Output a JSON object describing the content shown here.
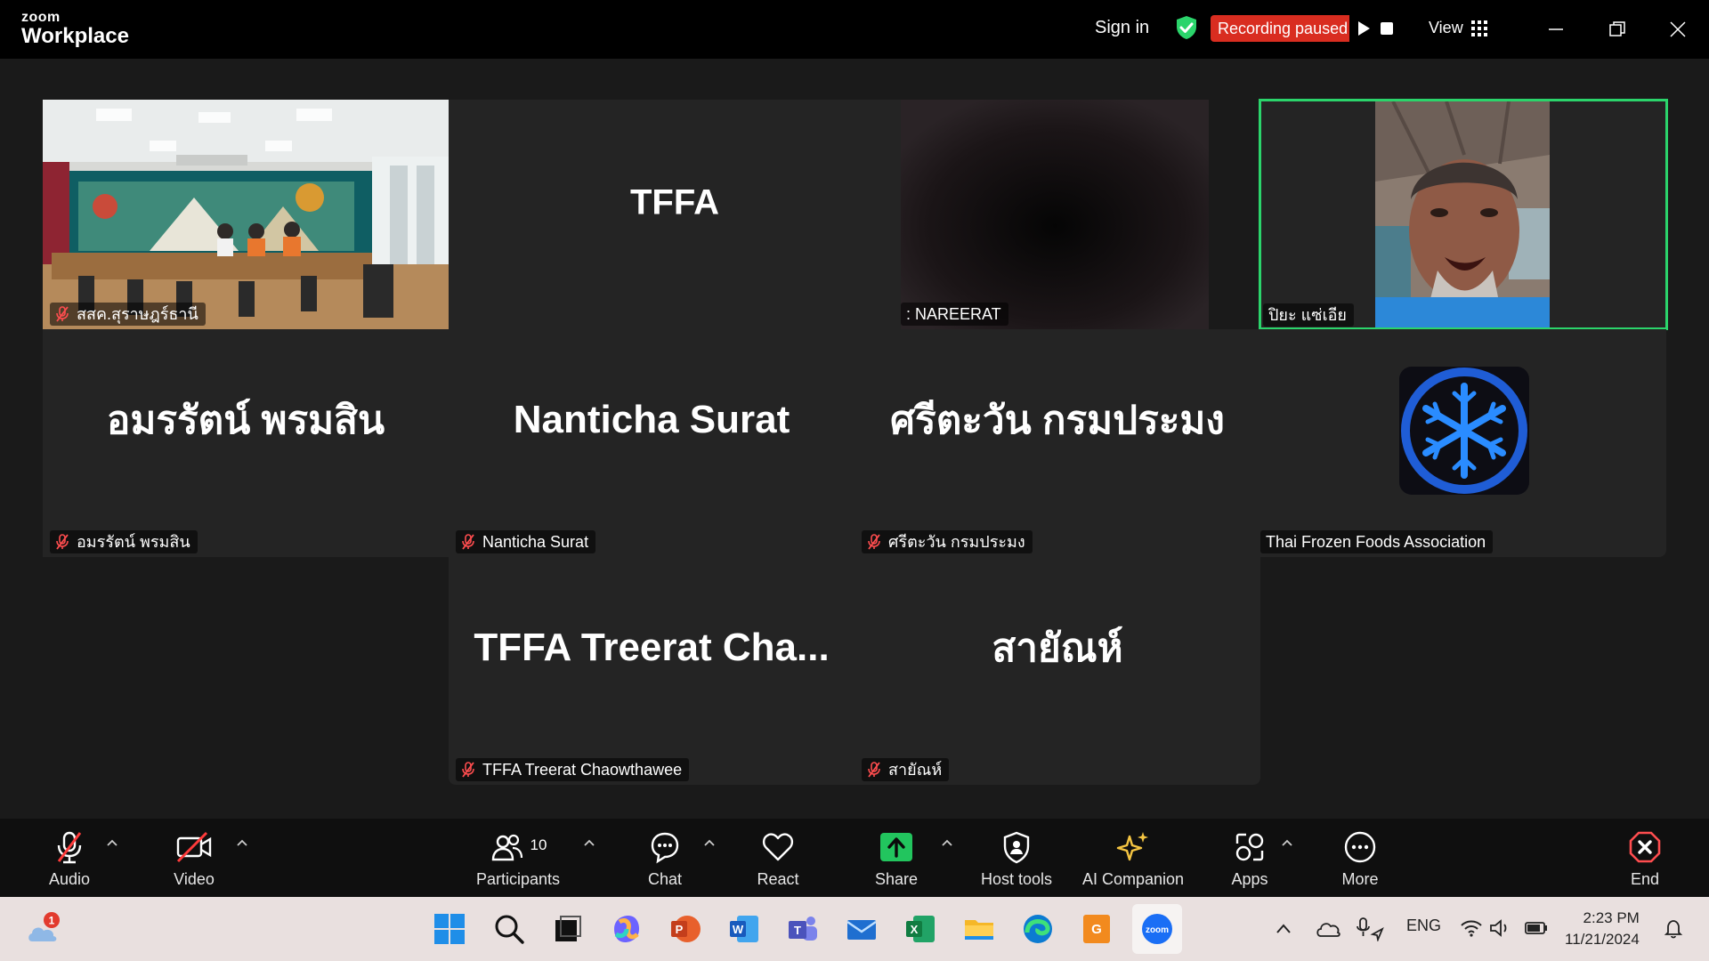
{
  "titlebar": {
    "logo_small": "zoom",
    "logo_big": "Workplace",
    "sign_in": "Sign in",
    "recording_status": "Recording paused",
    "view_label": "View"
  },
  "tiles": {
    "t1": {
      "name": "สสค.สุราษฎร์ธานี"
    },
    "t2": {
      "big": "TFFA"
    },
    "t3": {
      "name": ": NAREERAT"
    },
    "t4": {
      "name": "ปิยะ แซ่เอีย"
    },
    "t5": {
      "big": "อมรรัตน์ พรมสิน",
      "name": "อมรรัตน์ พรมสิน"
    },
    "t6": {
      "big": "Nanticha Surat",
      "name": "Nanticha Surat"
    },
    "t7": {
      "big": "ศรีตะวัน กรมประมง",
      "name": "ศรีตะวัน กรมประมง"
    },
    "t8": {
      "name": "Thai Frozen Foods Association"
    },
    "t9": {
      "big": "TFFA Treerat Cha...",
      "name": "TFFA Treerat Chaowthawee"
    },
    "t10": {
      "big": "สายัณห์",
      "name": "สายัณห์"
    }
  },
  "toolbar": {
    "audio": "Audio",
    "video": "Video",
    "participants": "Participants",
    "participants_count": "10",
    "chat": "Chat",
    "react": "React",
    "share": "Share",
    "host_tools": "Host tools",
    "ai_companion": "AI Companion",
    "apps": "Apps",
    "more": "More",
    "end": "End"
  },
  "taskbar": {
    "weather_badge": "1",
    "lang": "ENG",
    "time": "2:23 PM",
    "date": "11/21/2024"
  },
  "colors": {
    "accent_green": "#2bd46b",
    "record_red": "#d92d20",
    "share_green": "#22c55e"
  }
}
